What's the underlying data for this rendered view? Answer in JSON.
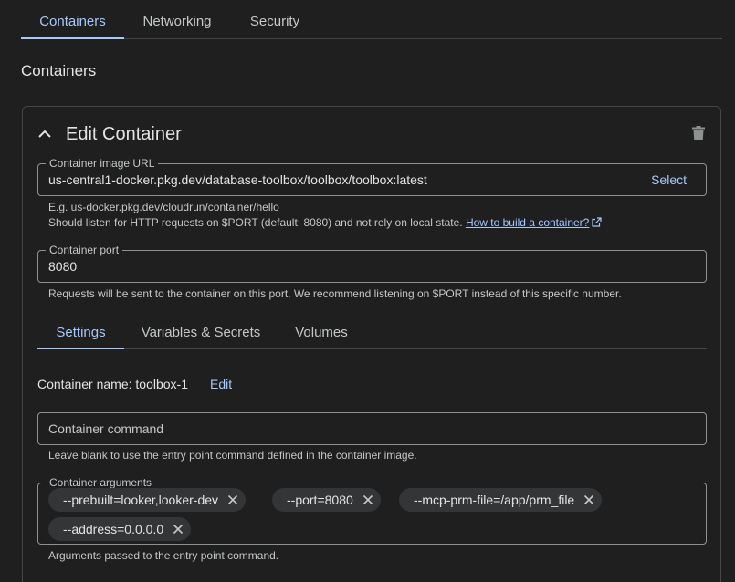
{
  "top_tabs": [
    {
      "label": "Containers",
      "active": true
    },
    {
      "label": "Networking",
      "active": false
    },
    {
      "label": "Security",
      "active": false
    }
  ],
  "section_title": "Containers",
  "card": {
    "title": "Edit Container",
    "image_field": {
      "label": "Container image URL",
      "value": "us-central1-docker.pkg.dev/database-toolbox/toolbox/toolbox:latest",
      "select_label": "Select",
      "helper_example": "E.g. us-docker.pkg.dev/cloudrun/container/hello",
      "helper_listen": "Should listen for HTTP requests on $PORT (default: 8080) and not rely on local state.",
      "helper_link": "How to build a container?"
    },
    "port_field": {
      "label": "Container port",
      "value": "8080",
      "helper": "Requests will be sent to the container on this port. We recommend listening on $PORT instead of this specific number."
    },
    "inner_tabs": [
      {
        "label": "Settings",
        "active": true
      },
      {
        "label": "Variables & Secrets",
        "active": false
      },
      {
        "label": "Volumes",
        "active": false
      }
    ],
    "container_name": {
      "label": "Container name: toolbox-1",
      "edit_label": "Edit"
    },
    "command_field": {
      "placeholder": "Container command",
      "helper": "Leave blank to use the entry point command defined in the container image."
    },
    "args_field": {
      "label": "Container arguments",
      "chips": [
        "--prebuilt=looker,looker-dev",
        "--port=8080",
        "--mcp-prm-file=/app/prm_file",
        "--address=0.0.0.0"
      ],
      "helper": "Arguments passed to the entry point command."
    }
  },
  "colors": {
    "background": "#1f1f1f",
    "accent": "#a8c7fa",
    "text": "#e3e3e3",
    "muted": "#c4c7c5",
    "outline": "#8e918f",
    "chip_bg": "#333537"
  },
  "icons": [
    "chevron-up-icon",
    "trash-icon",
    "external-link-icon",
    "close-icon"
  ]
}
